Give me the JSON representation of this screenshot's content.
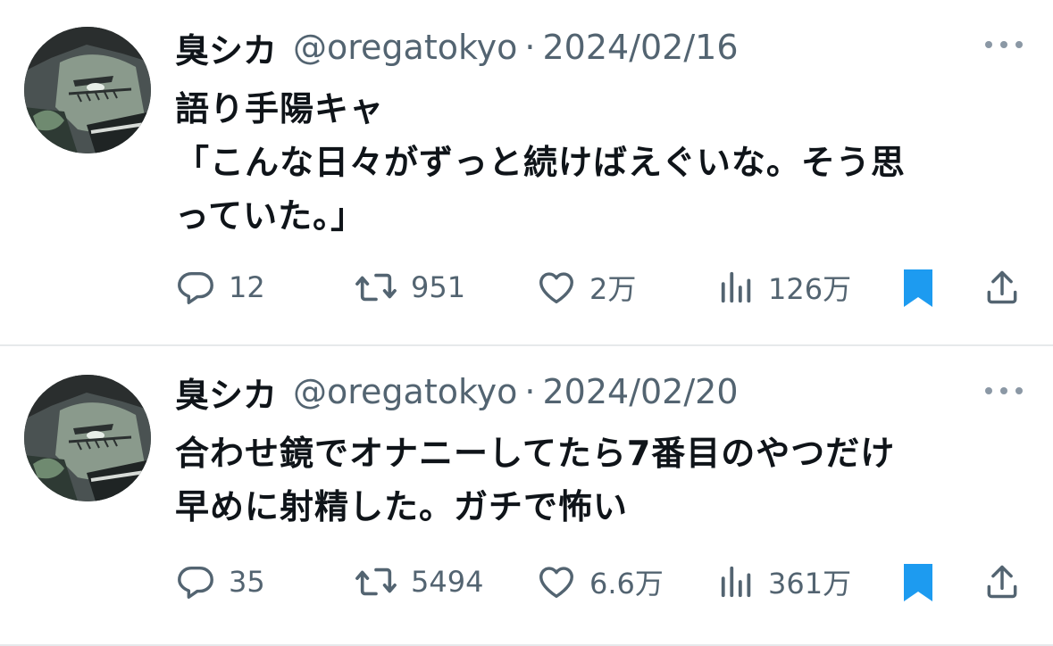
{
  "tweets": [
    {
      "name": "臭シカ",
      "handle": "@oregatokyo",
      "separator": "·",
      "date": "2024/02/16",
      "lines": [
        "語り手陽キャ",
        "「こんな日々がずっと続けばえぐいな。そう思",
        "っていた。」"
      ],
      "replies": "12",
      "retweets": "951",
      "likes": "2万",
      "views": "126万",
      "bookmarked": true
    },
    {
      "name": "臭シカ",
      "handle": "@oregatokyo",
      "separator": "·",
      "date": "2024/02/20",
      "lines": [
        "合わせ鏡でオナニーしてたら7番目のやつだけ",
        "早めに射精した。ガチで怖い"
      ],
      "replies": "35",
      "retweets": "5494",
      "likes": "6.6万",
      "views": "361万",
      "bookmarked": true
    }
  ],
  "colors": {
    "text": "#0f1419",
    "secondary": "#536471",
    "bookmark": "#1d9bf0",
    "divider": "#e6e9eb"
  },
  "icons": [
    "reply-icon",
    "retweet-icon",
    "like-icon",
    "views-icon",
    "bookmark-icon",
    "share-icon",
    "more-icon"
  ]
}
